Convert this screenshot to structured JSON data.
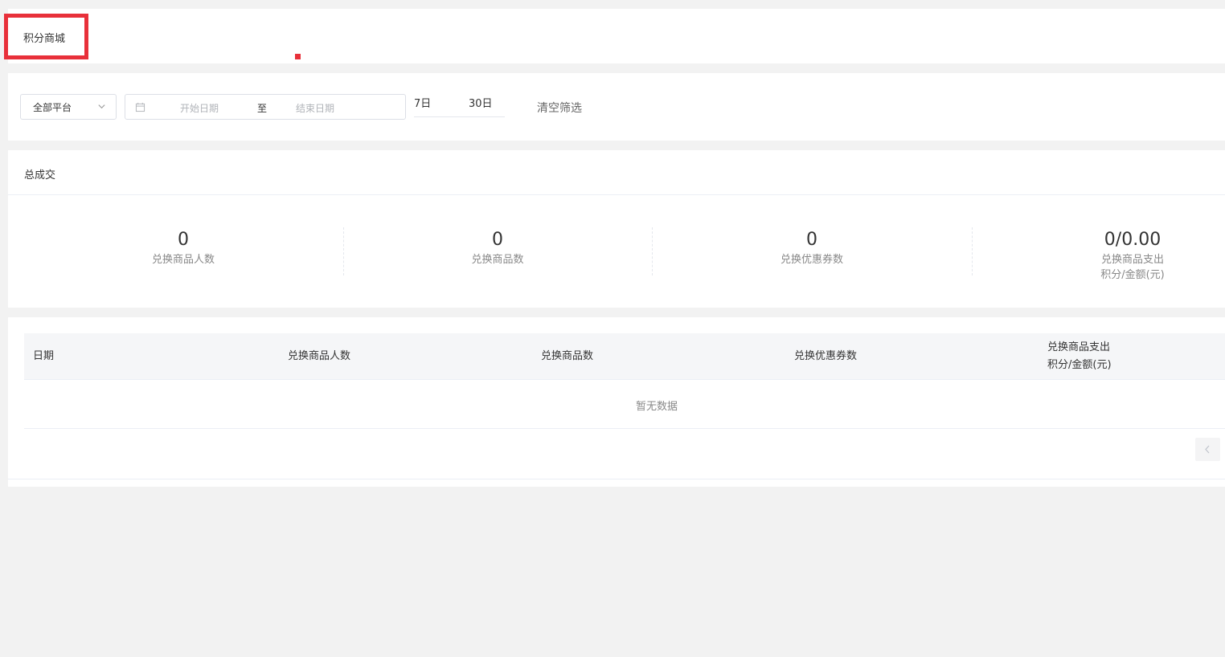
{
  "header": {
    "title": "积分商城"
  },
  "filters": {
    "platform_value": "全部平台",
    "start_placeholder": "开始日期",
    "range_separator": "至",
    "end_placeholder": "结束日期",
    "quick_7": "7日",
    "quick_30": "30日",
    "clear_label": "清空筛选"
  },
  "stats": {
    "section_title": "总成交",
    "items": [
      {
        "value": "0",
        "label": "兑换商品人数"
      },
      {
        "value": "0",
        "label": "兑换商品数"
      },
      {
        "value": "0",
        "label": "兑换优惠券数"
      },
      {
        "value": "0/0.00",
        "label_line1": "兑换商品支出",
        "label_line2": "积分/金额(元)"
      }
    ]
  },
  "table": {
    "columns": [
      {
        "label": "日期"
      },
      {
        "label": "兑换商品人数"
      },
      {
        "label": "兑换商品数"
      },
      {
        "label": "兑换优惠券数"
      },
      {
        "label_line1": "兑换商品支出",
        "label_line2": "积分/金额(元)"
      }
    ],
    "empty_text": "暂无数据"
  },
  "colors": {
    "accent_red": "#e8303a",
    "background": "#f2f2f2"
  }
}
